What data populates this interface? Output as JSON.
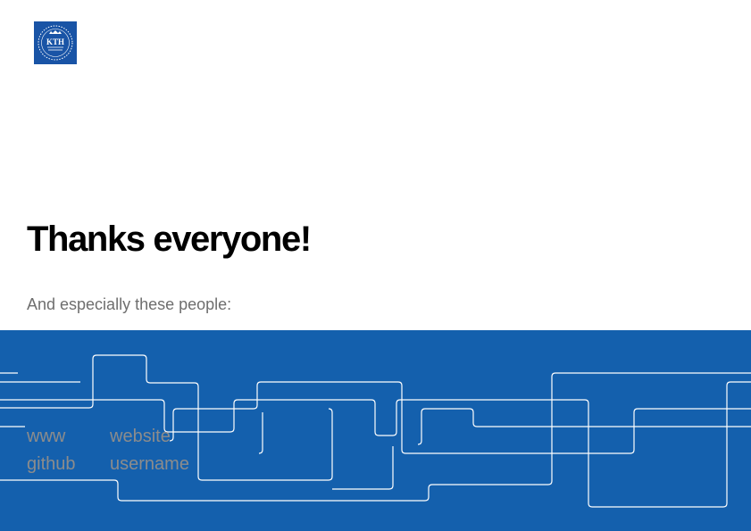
{
  "logo": {
    "text": "KTH",
    "icon": "kth-crest-icon",
    "color": "#1954a6"
  },
  "slide": {
    "title": "Thanks everyone!",
    "subtitle": "And especially these people:"
  },
  "contact": [
    {
      "label": "www",
      "value": "website"
    },
    {
      "label": "github",
      "value": "username"
    }
  ],
  "colors": {
    "band": "#1460ad",
    "line": "#ffffff",
    "title": "#000000",
    "subtitle": "#6e6e6e",
    "contact": "#8c8c8c"
  }
}
